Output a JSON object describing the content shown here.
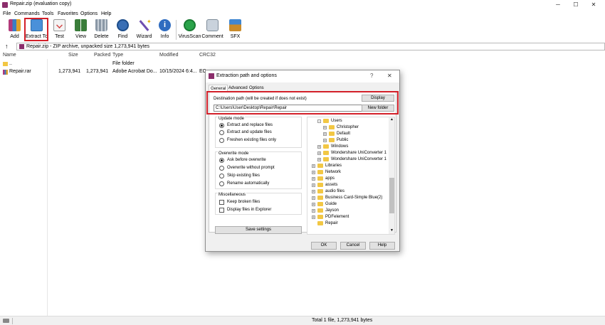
{
  "window": {
    "title": "Repair.zip (evaluation copy)"
  },
  "menu": [
    "File",
    "Commands",
    "Tools",
    "Favorites",
    "Options",
    "Help"
  ],
  "toolbar": [
    {
      "label": "Add",
      "icon": "add-archive-icon",
      "color": "#b23a7a"
    },
    {
      "label": "Extract To",
      "icon": "extract-folder-icon",
      "color": "#3f86d1"
    },
    {
      "label": "Test",
      "icon": "test-checklist-icon",
      "color": "#d34444"
    },
    {
      "label": "View",
      "icon": "view-book-icon",
      "color": "#3a7d3a"
    },
    {
      "label": "Delete",
      "icon": "trash-bin-icon",
      "color": "#8b98a6"
    },
    {
      "label": "Find",
      "icon": "magnifier-icon",
      "color": "#3a6fb5"
    },
    {
      "label": "Wizard",
      "icon": "magic-wand-icon",
      "color": "#6f4fb0"
    },
    {
      "label": "Info",
      "icon": "info-icon",
      "color": "#2f6cc0"
    },
    {
      "label": "VirusScan",
      "icon": "shield-scan-icon",
      "color": "#2aa34a"
    },
    {
      "label": "Comment",
      "icon": "comment-icon",
      "color": "#9aa7b5"
    },
    {
      "label": "SFX",
      "icon": "sfx-package-icon",
      "color": "#c98b2a"
    }
  ],
  "address": {
    "text": "Repair.zip - ZIP archive, unpacked size 1,273,941 bytes"
  },
  "filelist": {
    "columns": [
      "Name",
      "Size",
      "Packed",
      "Type",
      "Modified",
      "CRC32"
    ],
    "rows": [
      {
        "name": "..",
        "size": "",
        "packed": "",
        "type": "File folder",
        "modified": "",
        "crc": ""
      },
      {
        "name": "Repair.rar",
        "size": "1,273,941",
        "packed": "1,273,941",
        "type": "Adobe Acrobat Do...",
        "modified": "10/15/2024 6:4...",
        "crc": "EC"
      }
    ]
  },
  "status": {
    "right": "Total 1 file, 1,273,941 bytes"
  },
  "dialog": {
    "title": "Extraction path and options",
    "help_glyph": "?",
    "close_glyph": "✕",
    "tabs": [
      "General",
      "Advanced",
      "Options"
    ],
    "dest_label": "Destination path (will be created if does not exist)",
    "dest_value": "C:\\Users\\User\\Desktop\\Repair\\Repair",
    "display_btn": "Display",
    "newfolder_btn": "New folder",
    "update_mode": {
      "title": "Update mode",
      "options": [
        "Extract and replace files",
        "Extract and update files",
        "Freshen existing files only"
      ],
      "selected": 0
    },
    "overwrite_mode": {
      "title": "Overwrite mode",
      "options": [
        "Ask before overwrite",
        "Overwrite without prompt",
        "Skip existing files",
        "Rename automatically"
      ],
      "selected": 0
    },
    "misc": {
      "title": "Miscellaneous",
      "options": [
        "Keep broken files",
        "Display files in Explorer"
      ]
    },
    "save_btn": "Save settings",
    "tree": [
      {
        "label": "Users",
        "level": 1,
        "exp": "-"
      },
      {
        "label": "Christopher",
        "level": 2,
        "exp": "+"
      },
      {
        "label": "Default",
        "level": 2,
        "exp": "+"
      },
      {
        "label": "Public",
        "level": 2,
        "exp": "+"
      },
      {
        "label": "Windows",
        "level": 1,
        "exp": "+"
      },
      {
        "label": "Wondershare UniConverter 1",
        "level": 1,
        "exp": "+"
      },
      {
        "label": "Wondershare UniConverter 1",
        "level": 1,
        "exp": "+"
      },
      {
        "label": "Libraries",
        "level": 0,
        "exp": "+"
      },
      {
        "label": "Network",
        "level": 0,
        "exp": "+"
      },
      {
        "label": "apps",
        "level": 0,
        "exp": "+"
      },
      {
        "label": "assets",
        "level": 0,
        "exp": "+"
      },
      {
        "label": "audio files",
        "level": 0,
        "exp": "+"
      },
      {
        "label": "Business Card-Simple Blue(2)",
        "level": 0,
        "exp": "+"
      },
      {
        "label": "Guide",
        "level": 0,
        "exp": "+"
      },
      {
        "label": "Jayson",
        "level": 0,
        "exp": "+"
      },
      {
        "label": "PDFelement",
        "level": 0,
        "exp": "+"
      },
      {
        "label": "Repair",
        "level": 0,
        "exp": ""
      }
    ],
    "ok_btn": "OK",
    "cancel_btn": "Cancel",
    "help_btn": "Help"
  }
}
